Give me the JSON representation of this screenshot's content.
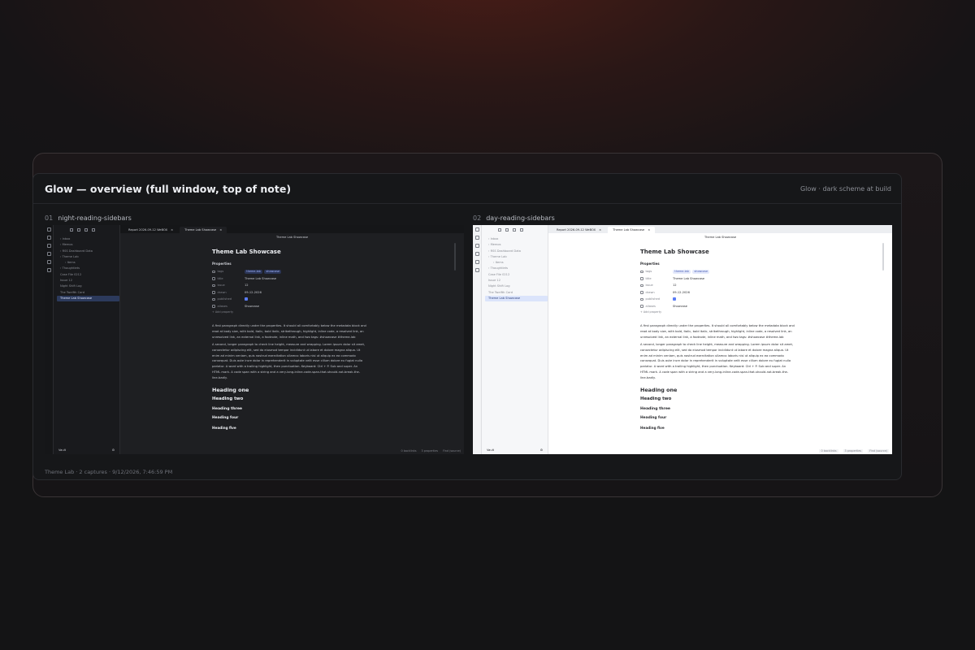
{
  "card": {
    "title": "Glow — overview (full window, top of note)",
    "subtitle": "Glow · dark scheme at build",
    "footer": "Theme Lab · 2 captures · 9/12/2026, 7:46:59 PM"
  },
  "captures": [
    {
      "num": "01",
      "label": "night-reading-sidebars",
      "mode": "dark",
      "tabs": [
        "Report 2026-09-12 WeBOX",
        "Theme Lab Showcase"
      ],
      "view_title": "Theme Lab Showcase",
      "sidebar_items": [
        {
          "label": "› Inbox",
          "sub": false,
          "active": false
        },
        {
          "label": "› Memos",
          "sub": false,
          "active": false
        },
        {
          "label": "› RSS Dashboard Data",
          "sub": false,
          "active": false
        },
        {
          "label": "› Theme Lab",
          "sub": false,
          "active": false
        },
        {
          "label": "› Items",
          "sub": true,
          "active": false
        },
        {
          "label": "› Thoughtlets",
          "sub": false,
          "active": false
        },
        {
          "label": "Case File 0212",
          "sub": false,
          "active": false
        },
        {
          "label": "Issue 12",
          "sub": false,
          "active": false
        },
        {
          "label": "Night Shift Log",
          "sub": false,
          "active": false
        },
        {
          "label": "The Twelfth Card",
          "sub": false,
          "active": false
        },
        {
          "label": "Theme Lab Showcase",
          "sub": false,
          "active": true
        }
      ],
      "vault": "Vault",
      "status": [
        "0 backlinks",
        "3 properties",
        "Find (source)"
      ]
    },
    {
      "num": "02",
      "label": "day-reading-sidebars",
      "mode": "light",
      "tabs": [
        "Report 2026-09-12 WeBOX",
        "Theme Lab Showcase"
      ],
      "view_title": "Theme Lab Showcase",
      "sidebar_items": [
        {
          "label": "› Inbox",
          "sub": false,
          "active": false
        },
        {
          "label": "› Memos",
          "sub": false,
          "active": false
        },
        {
          "label": "› RSS Dashboard Data",
          "sub": false,
          "active": false
        },
        {
          "label": "› Theme Lab",
          "sub": false,
          "active": false
        },
        {
          "label": "› Items",
          "sub": true,
          "active": false
        },
        {
          "label": "› Thoughtlets",
          "sub": false,
          "active": false
        },
        {
          "label": "Case File 0212",
          "sub": false,
          "active": false
        },
        {
          "label": "Issue 12",
          "sub": false,
          "active": false
        },
        {
          "label": "Night Shift Log",
          "sub": false,
          "active": false
        },
        {
          "label": "The Twelfth Card",
          "sub": false,
          "active": false
        },
        {
          "label": "Theme Lab Showcase",
          "sub": false,
          "active": true
        }
      ],
      "vault": "Vault",
      "status": [
        "0 backlinks",
        "3 properties",
        "Find (source)"
      ]
    }
  ],
  "note": {
    "title": "Theme Lab Showcase",
    "properties_heading": "Properties",
    "properties": [
      {
        "key": "tags",
        "tags": [
          "theme-lab",
          "showcase"
        ]
      },
      {
        "key": "title",
        "value": "Theme Lab Showcase"
      },
      {
        "key": "issue",
        "value": "12"
      },
      {
        "key": "drawn",
        "value": "09-12-2026"
      },
      {
        "key": "published",
        "check": true
      },
      {
        "key": "aliases",
        "value": "Showcase"
      }
    ],
    "add_property": "+ Add property",
    "para1": "A first paragraph directly under the properties. It should all comfortably below the metadata block and read at body size, with bold, italic, bold italic, strikethrough, highlight, inline code, a resolved link, an unresolved link, an external link, a footnote, inline math, and two tags: #showcase #theme-lab",
    "para2": "A second, longer paragraph to check line height, measure and wrapping. Lorem ipsum dolor sit amet, consectetur adipiscing elit, sed do eiusmod tempor incididunt ut labore et dolore magna aliqua. Ut enim ad minim veniam, quis nostrud exercitation ullamco laboris nisi ut aliquip ex ea commodo consequat. Duis aute irure dolor in reprehenderit in voluptate velit esse cillum dolore eu fugiat nulla pariatur. A word with a trailing highlight, then punctuation. Keyboard: Ctrl + P. Sub and super. An HTML mark. A code span with a string and a very-long-inline-code-span-that-should-not-break-the-line-badly.",
    "headings": [
      "Heading one",
      "Heading two",
      "Heading three",
      "Heading four",
      "Heading five"
    ]
  }
}
